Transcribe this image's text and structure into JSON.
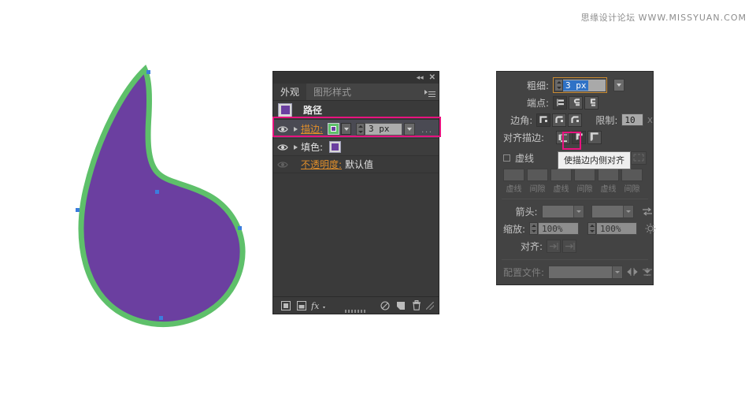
{
  "watermark": {
    "cn": "思缘设计论坛",
    "url": "WWW.MISSYUAN.COM"
  },
  "artwork": {
    "name": "teardrop-path",
    "fill_color": "#6b3fa0",
    "stroke_color": "#5ec06a",
    "anchor_color": "#3b7ddd"
  },
  "appearance_panel": {
    "collapse_icon": "◀◀",
    "close_icon": "✕",
    "tabs": [
      {
        "label": "外观",
        "active": true
      },
      {
        "label": "图形样式",
        "active": false
      }
    ],
    "rows": [
      {
        "label": "路径",
        "kind": "object-header"
      },
      {
        "label": "描边:",
        "kind": "stroke",
        "width_value": "3 px",
        "ellipsis": "..."
      },
      {
        "label": "填色:",
        "kind": "fill"
      },
      {
        "label": "不透明度:",
        "value": "默认值",
        "kind": "opacity"
      }
    ],
    "footer": {
      "add_new_stroke": "add-new-stroke",
      "add_new_fill": "add-new-fill",
      "fx": "fx",
      "clear": "clear-appearance",
      "duplicate": "duplicate-item",
      "delete": "delete-item"
    },
    "highlight_color": "#e8137f"
  },
  "stroke_panel": {
    "weight": {
      "label": "粗细:",
      "value": "3 px",
      "selected": true
    },
    "cap": {
      "label": "端点:",
      "options": [
        "butt-cap",
        "round-cap",
        "projecting-cap"
      ],
      "selected_index": 0
    },
    "corner": {
      "label": "边角:",
      "options": [
        "miter-join",
        "round-join",
        "bevel-join"
      ],
      "selected_index": 0
    },
    "limit": {
      "label": "限制:",
      "value": "10",
      "unit": "x"
    },
    "align_stroke": {
      "label": "对齐描边:",
      "options": [
        "align-stroke-center",
        "align-stroke-inside",
        "align-stroke-outside"
      ],
      "selected_index": 1,
      "tooltip": "使描边内侧对齐"
    },
    "dashed": {
      "label": "虚线",
      "checked": false,
      "fields": [
        {
          "caption": "虚线",
          "value": ""
        },
        {
          "caption": "间隙",
          "value": ""
        },
        {
          "caption": "虚线",
          "value": ""
        },
        {
          "caption": "间隙",
          "value": ""
        },
        {
          "caption": "虚线",
          "value": ""
        },
        {
          "caption": "间隙",
          "value": ""
        }
      ]
    },
    "arrowheads": {
      "label": "箭头:",
      "start_value": "",
      "end_value": "",
      "swap_icon": "swap-arrowheads-icon"
    },
    "scale": {
      "label": "缩放:",
      "start_value": "100%",
      "end_value": "100%",
      "link_icon": "link-scale-icon"
    },
    "align_ends": {
      "label": "对齐:",
      "options": [
        "extend-arrows-beyond-end",
        "place-arrows-at-end"
      ]
    },
    "profile": {
      "label": "配置文件:",
      "value": "",
      "flip_across_icon": "flip-across-icon",
      "flip_along_icon": "flip-along-icon"
    }
  }
}
